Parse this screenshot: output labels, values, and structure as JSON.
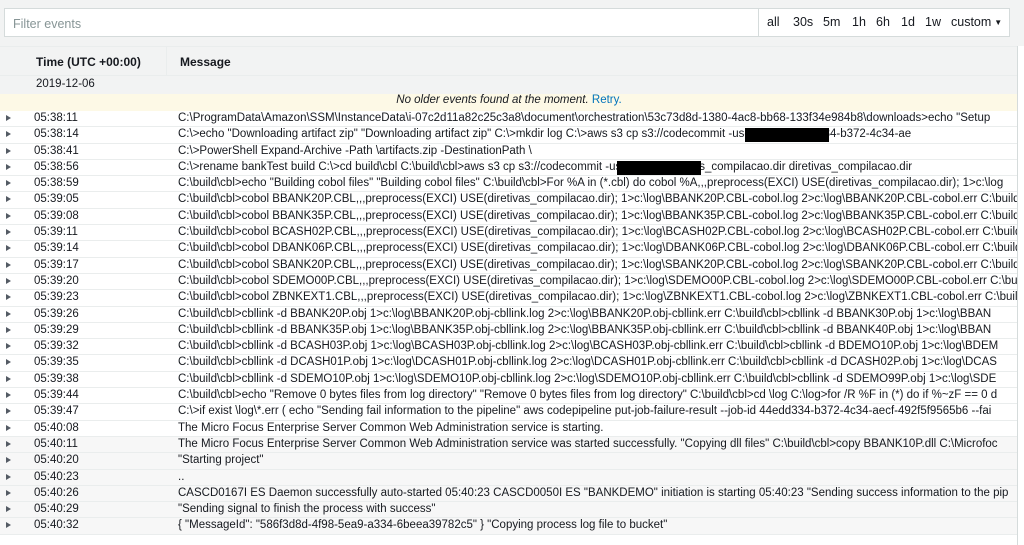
{
  "filter": {
    "placeholder": "Filter events",
    "value": ""
  },
  "time_range": {
    "options": [
      "all",
      "30s",
      "5m",
      "1h",
      "6h",
      "1d",
      "1w"
    ],
    "custom_label": "custom"
  },
  "table": {
    "headers": {
      "time": "Time (UTC +00:00)",
      "message": "Message"
    },
    "date_group": "2019-12-06",
    "notice": {
      "text": "No older events found at the moment.",
      "retry": "Retry."
    },
    "rows": [
      {
        "time": "05:38:11",
        "message": "C:\\ProgramData\\Amazon\\SSM\\InstanceData\\i-07c2d11a82c25c3a8\\document\\orchestration\\53c73d8d-1380-4ac8-bb68-133f34e984b8\\downloads>echo \"Setup"
      },
      {
        "time": "05:38:14",
        "message": "C:\\>echo \"Downloading artifact zip\" \"Downloading artifact zip\" C:\\>mkdir log C:\\>aws s3 cp s3://codecommit                                      -us-west-2/44edd334-b372-4c34-ae"
      },
      {
        "time": "05:38:41",
        "message": "C:\\>PowerShell Expand-Archive -Path \\artifacts.zip -DestinationPath \\"
      },
      {
        "time": "05:38:56",
        "message": "C:\\>rename bankTest build C:\\>cd build\\cbl C:\\build\\cbl>aws s3 cp s3://codecommit                                      -us-west-2/diretivas_compilacao.dir diretivas_compilacao.dir"
      },
      {
        "time": "05:38:59",
        "message": "C:\\build\\cbl>echo \"Building cobol files\" \"Building cobol files\" C:\\build\\cbl>For %A in (*.cbl) do cobol %A,,,preprocess(EXCI) USE(diretivas_compilacao.dir); 1>c:\\log"
      },
      {
        "time": "05:39:05",
        "message": "C:\\build\\cbl>cobol BBANK20P.CBL,,,preprocess(EXCI) USE(diretivas_compilacao.dir); 1>c:\\log\\BBANK20P.CBL-cobol.log 2>c:\\log\\BBANK20P.CBL-cobol.err C:\\build"
      },
      {
        "time": "05:39:08",
        "message": "C:\\build\\cbl>cobol BBANK35P.CBL,,,preprocess(EXCI) USE(diretivas_compilacao.dir); 1>c:\\log\\BBANK35P.CBL-cobol.log 2>c:\\log\\BBANK35P.CBL-cobol.err C:\\build"
      },
      {
        "time": "05:39:11",
        "message": "C:\\build\\cbl>cobol BCASH02P.CBL,,,preprocess(EXCI) USE(diretivas_compilacao.dir); 1>c:\\log\\BCASH02P.CBL-cobol.log 2>c:\\log\\BCASH02P.CBL-cobol.err C:\\build"
      },
      {
        "time": "05:39:14",
        "message": "C:\\build\\cbl>cobol DBANK06P.CBL,,,preprocess(EXCI) USE(diretivas_compilacao.dir); 1>c:\\log\\DBANK06P.CBL-cobol.log 2>c:\\log\\DBANK06P.CBL-cobol.err C:\\build"
      },
      {
        "time": "05:39:17",
        "message": "C:\\build\\cbl>cobol SBANK20P.CBL,,,preprocess(EXCI) USE(diretivas_compilacao.dir); 1>c:\\log\\SBANK20P.CBL-cobol.log 2>c:\\log\\SBANK20P.CBL-cobol.err C:\\build"
      },
      {
        "time": "05:39:20",
        "message": "C:\\build\\cbl>cobol SDEMO00P.CBL,,,preprocess(EXCI) USE(diretivas_compilacao.dir); 1>c:\\log\\SDEMO00P.CBL-cobol.log 2>c:\\log\\SDEMO00P.CBL-cobol.err C:\\build"
      },
      {
        "time": "05:39:23",
        "message": "C:\\build\\cbl>cobol ZBNKEXT1.CBL,,,preprocess(EXCI) USE(diretivas_compilacao.dir); 1>c:\\log\\ZBNKEXT1.CBL-cobol.log 2>c:\\log\\ZBNKEXT1.CBL-cobol.err C:\\build"
      },
      {
        "time": "05:39:26",
        "message": "C:\\build\\cbl>cbllink -d BBANK20P.obj 1>c:\\log\\BBANK20P.obj-cbllink.log 2>c:\\log\\BBANK20P.obj-cbllink.err C:\\build\\cbl>cbllink -d BBANK30P.obj 1>c:\\log\\BBAN"
      },
      {
        "time": "05:39:29",
        "message": "C:\\build\\cbl>cbllink -d BBANK35P.obj 1>c:\\log\\BBANK35P.obj-cbllink.log 2>c:\\log\\BBANK35P.obj-cbllink.err C:\\build\\cbl>cbllink -d BBANK40P.obj 1>c:\\log\\BBAN"
      },
      {
        "time": "05:39:32",
        "message": "C:\\build\\cbl>cbllink -d BCASH03P.obj 1>c:\\log\\BCASH03P.obj-cbllink.log 2>c:\\log\\BCASH03P.obj-cbllink.err C:\\build\\cbl>cbllink -d BDEMO10P.obj 1>c:\\log\\BDEM"
      },
      {
        "time": "05:39:35",
        "message": "C:\\build\\cbl>cbllink -d DCASH01P.obj 1>c:\\log\\DCASH01P.obj-cbllink.log 2>c:\\log\\DCASH01P.obj-cbllink.err C:\\build\\cbl>cbllink -d DCASH02P.obj 1>c:\\log\\DCAS"
      },
      {
        "time": "05:39:38",
        "message": "C:\\build\\cbl>cbllink -d SDEMO10P.obj 1>c:\\log\\SDEMO10P.obj-cbllink.log 2>c:\\log\\SDEMO10P.obj-cbllink.err C:\\build\\cbl>cbllink -d SDEMO99P.obj 1>c:\\log\\SDE"
      },
      {
        "time": "05:39:44",
        "message": "C:\\build\\cbl>echo \"Remove 0 bytes files from log directory\" \"Remove 0 bytes files from log directory\" C:\\build\\cbl>cd \\log C:\\log>for /R %F in (*) do if %~zF == 0 d"
      },
      {
        "time": "05:39:47",
        "message": "C:\\>if exist \\log\\*.err ( echo \"Sending fail information to the pipeline\" aws codepipeline put-job-failure-result --job-id 44edd334-b372-4c34-aecf-492f5f9565b6 --fai"
      },
      {
        "time": "05:40:08",
        "message": "The Micro Focus Enterprise Server Common Web Administration service is starting."
      },
      {
        "time": "05:40:11",
        "message": "The Micro Focus Enterprise Server Common Web Administration service was started successfully. \"Copying dll files\" C:\\build\\cbl>copy BBANK10P.dll C:\\Microfoc"
      },
      {
        "time": "05:40:20",
        "message": "\"Starting project\""
      },
      {
        "time": "05:40:23",
        "message": ".."
      },
      {
        "time": "05:40:26",
        "message": "CASCD0167I ES Daemon successfully auto-started 05:40:23 CASCD0050I ES \"BANKDEMO\" initiation is starting 05:40:23 \"Sending success information to the pip"
      },
      {
        "time": "05:40:29",
        "message": "\"Sending signal to finish the process with success\""
      },
      {
        "time": "05:40:32",
        "message": "{ \"MessageId\": \"586f3d8d-4f98-5ea9-a334-6beea39782c5\" } \"Copying process log file to bucket\""
      }
    ]
  },
  "colors": {
    "header_bg": "#f2f3f3",
    "notice_bg": "#fdf9e6",
    "link": "#0073bb",
    "text": "#16191f"
  }
}
